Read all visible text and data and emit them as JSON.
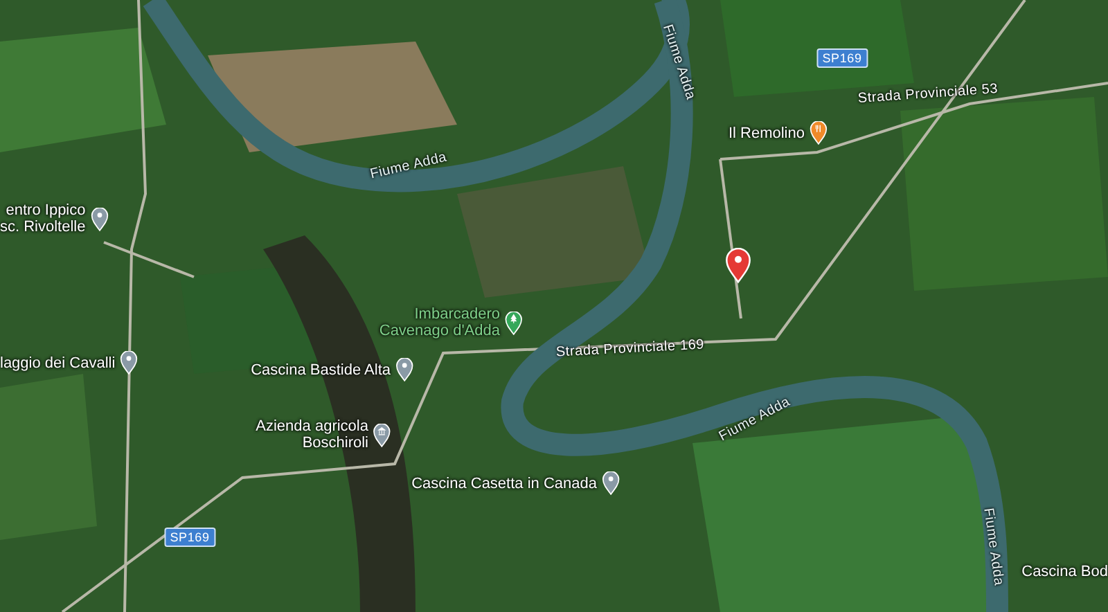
{
  "map": {
    "places": [
      {
        "kind": "poi",
        "lines": [
          "entro Ippico",
          "sc. Rivoltelle"
        ]
      },
      {
        "kind": "restaurant",
        "lines": [
          "Il Remolino"
        ]
      },
      {
        "kind": "selected"
      },
      {
        "kind": "park",
        "lines": [
          "Imbarcadero",
          "Cavenago d'Adda"
        ]
      },
      {
        "kind": "poi",
        "lines": [
          "laggio dei Cavalli"
        ]
      },
      {
        "kind": "poi",
        "lines": [
          "Cascina Bastide Alta"
        ]
      },
      {
        "kind": "museum",
        "lines": [
          "Azienda agricola",
          "Boschiroli"
        ]
      },
      {
        "kind": "poi",
        "lines": [
          "Cascina Casetta in Canada"
        ]
      },
      {
        "kind": "plain",
        "lines": [
          "Cascina Bod"
        ]
      }
    ],
    "labels": [
      {
        "kind": "river",
        "text": "Fiume Adda"
      },
      {
        "kind": "river",
        "text": "Fiume Adda"
      },
      {
        "kind": "shield",
        "text": "SP169"
      },
      {
        "kind": "road",
        "text": "Strada Provinciale 53"
      },
      {
        "kind": "road",
        "text": "Strada Provinciale 169"
      },
      {
        "kind": "river",
        "text": "Fiume Adda"
      },
      {
        "kind": "river",
        "text": "Fiume Adda"
      },
      {
        "kind": "shield",
        "text": "SP169"
      }
    ]
  }
}
